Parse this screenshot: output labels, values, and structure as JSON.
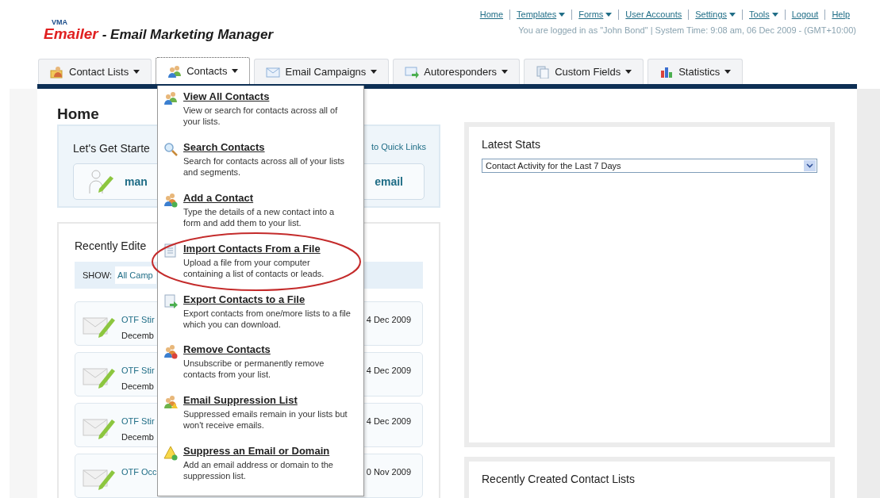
{
  "header": {
    "logo": {
      "brand_small": "VMA",
      "brand": "Emailer",
      "title": "- Email Marketing Manager"
    },
    "top_links": [
      {
        "label": "Home",
        "dropdown": false
      },
      {
        "label": "Templates",
        "dropdown": true
      },
      {
        "label": "Forms",
        "dropdown": true
      },
      {
        "label": "User Accounts",
        "dropdown": false
      },
      {
        "label": "Settings",
        "dropdown": true
      },
      {
        "label": "Tools",
        "dropdown": true
      },
      {
        "label": "Logout",
        "dropdown": false
      },
      {
        "label": "Help",
        "dropdown": false
      }
    ],
    "login_info": "You are logged in as \"John Bond\" | System Time: 9:08 am, 06 Dec 2009 - (GMT+10:00)"
  },
  "tabs": [
    {
      "label": "Contact Lists",
      "selected": false
    },
    {
      "label": "Contacts",
      "selected": true
    },
    {
      "label": "Email Campaigns",
      "selected": false
    },
    {
      "label": "Autoresponders",
      "selected": false
    },
    {
      "label": "Custom Fields",
      "selected": false
    },
    {
      "label": "Statistics",
      "selected": false
    }
  ],
  "contacts_menu": {
    "items": [
      {
        "title": "View All Contacts",
        "description": "View or search for contacts across all of your lists.",
        "circled": false
      },
      {
        "title": "Search Contacts",
        "description": "Search for contacts across all of your lists and segments.",
        "circled": false
      },
      {
        "title": "Add a Contact",
        "description": "Type the details of a new contact into a form and add them to your list.",
        "circled": false
      },
      {
        "title": "Import Contacts From a File",
        "description": "Upload a file from your computer containing a list of contacts or leads.",
        "circled": true
      },
      {
        "title": "Export Contacts to a File",
        "description": "Export contacts from one/more lists to a file which you can download.",
        "circled": false
      },
      {
        "title": "Remove Contacts",
        "description": "Unsubscribe or permanently remove contacts from your list.",
        "circled": false
      },
      {
        "title": "Email Suppression List",
        "description": "Suppressed emails remain in your lists but won't receive emails.",
        "circled": false
      },
      {
        "title": "Suppress an Email or Domain",
        "description": "Add an email address or domain to the suppression list.",
        "circled": false
      }
    ]
  },
  "page_title": "Home",
  "get_started": {
    "title": "Let's Get Starte",
    "link": "to Quick Links",
    "button_left": "man",
    "button_right": "email"
  },
  "recently_edited": {
    "title": "Recently Edite",
    "show_label": "SHOW:",
    "show_value": "All Camp",
    "rows": [
      {
        "name": "OTF Stir",
        "subtitle": "Decemb",
        "date": "4 Dec 2009"
      },
      {
        "name": "OTF Stir",
        "subtitle": "Decemb",
        "date": "4 Dec 2009"
      },
      {
        "name": "OTF Stir",
        "subtitle": "Decemb",
        "date": "4 Dec 2009"
      },
      {
        "name": "OTF Occ",
        "date": "0 Nov 2009"
      }
    ]
  },
  "latest_stats": {
    "title": "Latest Stats",
    "select": "Contact Activity for the Last 7 Days"
  },
  "recent_lists": {
    "title": "Recently Created Contact Lists"
  }
}
